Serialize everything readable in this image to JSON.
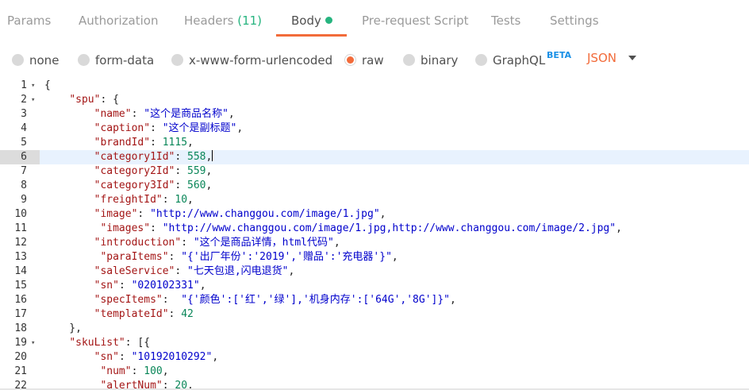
{
  "tabs": [
    {
      "label": "Params"
    },
    {
      "label": "Authorization"
    },
    {
      "label": "Headers",
      "count": "(11)"
    },
    {
      "label": "Body"
    },
    {
      "label": "Pre-request Script"
    },
    {
      "label": "Tests"
    },
    {
      "label": "Settings"
    }
  ],
  "body_types": [
    {
      "label": "none"
    },
    {
      "label": "form-data"
    },
    {
      "label": "x-www-form-urlencoded"
    },
    {
      "label": "raw",
      "selected": true
    },
    {
      "label": "binary"
    },
    {
      "label": "GraphQL",
      "badge": "BETA"
    }
  ],
  "format_select": "JSON",
  "colors": {
    "accent": "#f26b3a",
    "green": "#26b47f",
    "beta": "#1a90e6"
  },
  "icons": {
    "dropdown": "chevron-down-icon",
    "fold": "fold-triangle-icon"
  },
  "editor": {
    "current_line": 6,
    "lines": [
      {
        "n": "1",
        "fold": true,
        "tokens": [
          {
            "t": "p",
            "v": "{"
          }
        ]
      },
      {
        "n": "2",
        "fold": true,
        "tokens": [
          {
            "t": "p",
            "v": "    "
          },
          {
            "t": "k",
            "v": "\"spu\""
          },
          {
            "t": "p",
            "v": ": {"
          }
        ]
      },
      {
        "n": "3",
        "tokens": [
          {
            "t": "p",
            "v": "        "
          },
          {
            "t": "k",
            "v": "\"name\""
          },
          {
            "t": "p",
            "v": ": "
          },
          {
            "t": "s",
            "v": "\"这个是商品名称\""
          },
          {
            "t": "p",
            "v": ","
          }
        ]
      },
      {
        "n": "4",
        "tokens": [
          {
            "t": "p",
            "v": "        "
          },
          {
            "t": "k",
            "v": "\"caption\""
          },
          {
            "t": "p",
            "v": ": "
          },
          {
            "t": "s",
            "v": "\"这个是副标题\""
          },
          {
            "t": "p",
            "v": ","
          }
        ]
      },
      {
        "n": "5",
        "tokens": [
          {
            "t": "p",
            "v": "        "
          },
          {
            "t": "k",
            "v": "\"brandId\""
          },
          {
            "t": "p",
            "v": ": "
          },
          {
            "t": "n",
            "v": "1115"
          },
          {
            "t": "p",
            "v": ","
          }
        ]
      },
      {
        "n": "6",
        "cursor": true,
        "tokens": [
          {
            "t": "p",
            "v": "        "
          },
          {
            "t": "k",
            "v": "\"category1Id\""
          },
          {
            "t": "p",
            "v": ": "
          },
          {
            "t": "n",
            "v": "558"
          },
          {
            "t": "p",
            "v": ","
          }
        ]
      },
      {
        "n": "7",
        "tokens": [
          {
            "t": "p",
            "v": "        "
          },
          {
            "t": "k",
            "v": "\"category2Id\""
          },
          {
            "t": "p",
            "v": ": "
          },
          {
            "t": "n",
            "v": "559"
          },
          {
            "t": "p",
            "v": ","
          }
        ]
      },
      {
        "n": "8",
        "tokens": [
          {
            "t": "p",
            "v": "        "
          },
          {
            "t": "k",
            "v": "\"category3Id\""
          },
          {
            "t": "p",
            "v": ": "
          },
          {
            "t": "n",
            "v": "560"
          },
          {
            "t": "p",
            "v": ","
          }
        ]
      },
      {
        "n": "9",
        "tokens": [
          {
            "t": "p",
            "v": "        "
          },
          {
            "t": "k",
            "v": "\"freightId\""
          },
          {
            "t": "p",
            "v": ": "
          },
          {
            "t": "n",
            "v": "10"
          },
          {
            "t": "p",
            "v": ","
          }
        ]
      },
      {
        "n": "10",
        "tokens": [
          {
            "t": "p",
            "v": "        "
          },
          {
            "t": "k",
            "v": "\"image\""
          },
          {
            "t": "p",
            "v": ": "
          },
          {
            "t": "s",
            "v": "\"http://www.changgou.com/image/1.jpg\""
          },
          {
            "t": "p",
            "v": ","
          }
        ]
      },
      {
        "n": "11",
        "tokens": [
          {
            "t": "p",
            "v": "         "
          },
          {
            "t": "k",
            "v": "\"images\""
          },
          {
            "t": "p",
            "v": ": "
          },
          {
            "t": "s",
            "v": "\"http://www.changgou.com/image/1.jpg,http://www.changgou.com/image/2.jpg\""
          },
          {
            "t": "p",
            "v": ","
          }
        ]
      },
      {
        "n": "12",
        "tokens": [
          {
            "t": "p",
            "v": "        "
          },
          {
            "t": "k",
            "v": "\"introduction\""
          },
          {
            "t": "p",
            "v": ": "
          },
          {
            "t": "s",
            "v": "\"这个是商品详情，html代码\""
          },
          {
            "t": "p",
            "v": ","
          }
        ]
      },
      {
        "n": "13",
        "tokens": [
          {
            "t": "p",
            "v": "         "
          },
          {
            "t": "k",
            "v": "\"paraItems\""
          },
          {
            "t": "p",
            "v": ": "
          },
          {
            "t": "s",
            "v": "\"{'出厂年份':'2019','赠品':'充电器'}\""
          },
          {
            "t": "p",
            "v": ","
          }
        ]
      },
      {
        "n": "14",
        "tokens": [
          {
            "t": "p",
            "v": "        "
          },
          {
            "t": "k",
            "v": "\"saleService\""
          },
          {
            "t": "p",
            "v": ": "
          },
          {
            "t": "s",
            "v": "\"七天包退,闪电退货\""
          },
          {
            "t": "p",
            "v": ","
          }
        ]
      },
      {
        "n": "15",
        "tokens": [
          {
            "t": "p",
            "v": "        "
          },
          {
            "t": "k",
            "v": "\"sn\""
          },
          {
            "t": "p",
            "v": ": "
          },
          {
            "t": "s",
            "v": "\"020102331\""
          },
          {
            "t": "p",
            "v": ","
          }
        ]
      },
      {
        "n": "16",
        "tokens": [
          {
            "t": "p",
            "v": "        "
          },
          {
            "t": "k",
            "v": "\"specItems\""
          },
          {
            "t": "p",
            "v": ":  "
          },
          {
            "t": "s",
            "v": "\"{'颜色':['红','绿'],'机身内存':['64G','8G']}\""
          },
          {
            "t": "p",
            "v": ","
          }
        ]
      },
      {
        "n": "17",
        "tokens": [
          {
            "t": "p",
            "v": "        "
          },
          {
            "t": "k",
            "v": "\"templateId\""
          },
          {
            "t": "p",
            "v": ": "
          },
          {
            "t": "n",
            "v": "42"
          }
        ]
      },
      {
        "n": "18",
        "tokens": [
          {
            "t": "p",
            "v": "    },"
          }
        ]
      },
      {
        "n": "19",
        "fold": true,
        "tokens": [
          {
            "t": "p",
            "v": "    "
          },
          {
            "t": "k",
            "v": "\"skuList\""
          },
          {
            "t": "p",
            "v": ": [{"
          }
        ]
      },
      {
        "n": "20",
        "tokens": [
          {
            "t": "p",
            "v": "        "
          },
          {
            "t": "k",
            "v": "\"sn\""
          },
          {
            "t": "p",
            "v": ": "
          },
          {
            "t": "s",
            "v": "\"10192010292\""
          },
          {
            "t": "p",
            "v": ","
          }
        ]
      },
      {
        "n": "21",
        "tokens": [
          {
            "t": "p",
            "v": "         "
          },
          {
            "t": "k",
            "v": "\"num\""
          },
          {
            "t": "p",
            "v": ": "
          },
          {
            "t": "n",
            "v": "100"
          },
          {
            "t": "p",
            "v": ","
          }
        ]
      },
      {
        "n": "22",
        "tokens": [
          {
            "t": "p",
            "v": "         "
          },
          {
            "t": "k",
            "v": "\"alertNum\""
          },
          {
            "t": "p",
            "v": ": "
          },
          {
            "t": "n",
            "v": "20"
          },
          {
            "t": "p",
            "v": ","
          }
        ]
      }
    ]
  }
}
